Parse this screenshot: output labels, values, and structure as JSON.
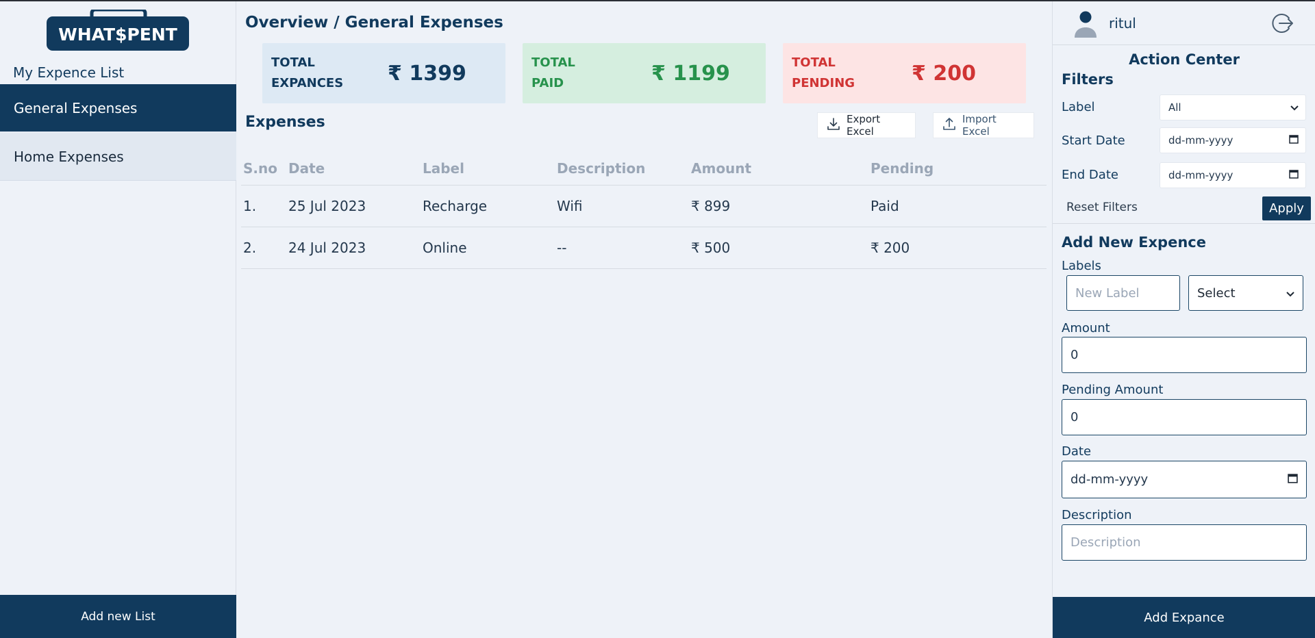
{
  "brand": {
    "name": "WHAT$PENT"
  },
  "sidebar": {
    "heading": "My Expence List",
    "items": [
      {
        "label": "General Expenses",
        "active": true
      },
      {
        "label": "Home Expenses",
        "active": false
      }
    ],
    "add_list_label": "Add new List"
  },
  "main": {
    "title": "Overview / General Expenses",
    "cards": [
      {
        "label_line1": "TOTAL",
        "label_line2": "EXPANCES",
        "value": "₹ 1399"
      },
      {
        "label_line1": "TOTAL",
        "label_line2": "PAID",
        "value": "₹ 1199"
      },
      {
        "label_line1": "TOTAL",
        "label_line2": "PENDING",
        "value": "₹ 200"
      }
    ],
    "section_title": "Expenses",
    "export_label": "Export Excel",
    "import_label": "Import Excel",
    "table": {
      "columns": [
        "S.no",
        "Date",
        "Label",
        "Description",
        "Amount",
        "Pending"
      ],
      "rows": [
        [
          "1.",
          "25 Jul 2023",
          "Recharge",
          "Wifi",
          "₹ 899",
          "Paid"
        ],
        [
          "2.",
          "24 Jul 2023",
          "Online",
          "--",
          "₹ 500",
          "₹ 200"
        ]
      ]
    }
  },
  "right": {
    "username": "ritul",
    "action_center": "Action Center",
    "filters_title": "Filters",
    "filters": {
      "label_label": "Label",
      "label_value": "All",
      "start_label": "Start Date",
      "start_value": "dd-mm-yyyy",
      "end_label": "End Date",
      "end_value": "dd-mm-yyyy",
      "reset_label": "Reset Filters",
      "apply_label": "Apply"
    },
    "add_title": "Add New Expence",
    "form": {
      "labels_label": "Labels",
      "new_label_placeholder": "New Label",
      "select_value": "Select",
      "amount_label": "Amount",
      "amount_value": "0",
      "pending_label": "Pending Amount",
      "pending_value": "0",
      "date_label": "Date",
      "date_value": "dd-mm-yyyy",
      "description_label": "Description",
      "description_placeholder": "Description"
    },
    "add_button": "Add Expance"
  },
  "colors": {
    "primary": "#113a5d",
    "paid": "#2d9a55",
    "pending": "#d03434",
    "card_blue": "#dde9f4",
    "card_green": "#d5eedf",
    "card_red": "#fde4e4"
  }
}
